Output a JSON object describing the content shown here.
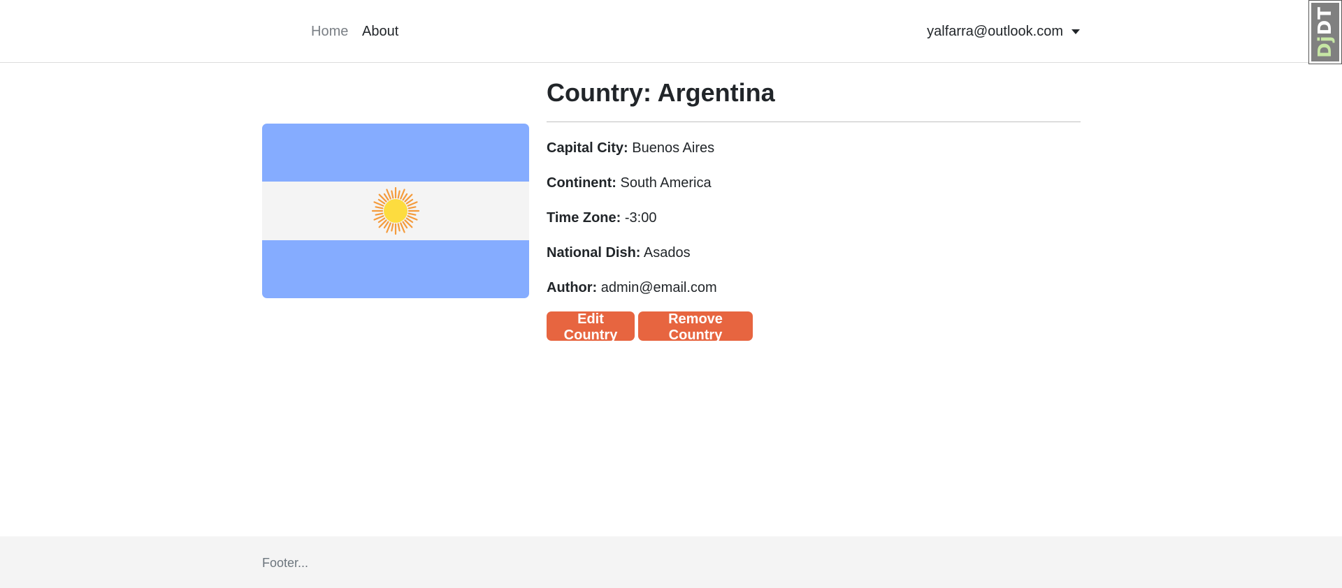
{
  "nav": {
    "home_label": "Home",
    "about_label": "About",
    "user_email": "yalfarra@outlook.com"
  },
  "toolbar": {
    "prefix": "Dj",
    "suffix": "DT"
  },
  "country": {
    "title": "Country: Argentina",
    "fields": [
      {
        "label": "Capital City:",
        "value": "Buenos Aires"
      },
      {
        "label": "Continent:",
        "value": "South America"
      },
      {
        "label": "Time Zone:",
        "value": "-3:00"
      },
      {
        "label": "National Dish:",
        "value": "Asados"
      },
      {
        "label": "Author:",
        "value": "admin@email.com"
      }
    ],
    "flag": {
      "stripe_color": "#85acff",
      "middle_color": "#f4f4f4",
      "sun_color": "#fddc3f",
      "ray_color": "#f49b3c"
    }
  },
  "actions": {
    "edit_label": "Edit Country",
    "remove_label": "Remove Country",
    "button_color": "#e76540"
  },
  "footer": {
    "text": "Footer..."
  }
}
